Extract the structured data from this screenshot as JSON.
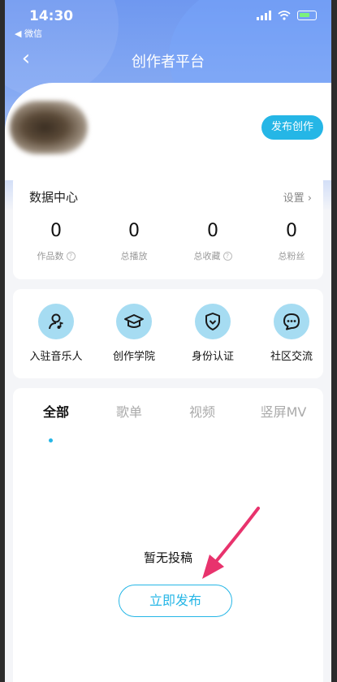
{
  "status_bar": {
    "time": "14:30",
    "back_app": "◀ 微信"
  },
  "nav": {
    "title": "创作者平台",
    "back_glyph": "‹"
  },
  "profile": {
    "publish_create_label": "发布创作"
  },
  "data_center": {
    "title": "数据中心",
    "settings_label": "设置 ›",
    "stats": [
      {
        "value": "0",
        "label": "作品数",
        "has_help": true
      },
      {
        "value": "0",
        "label": "总播放",
        "has_help": false
      },
      {
        "value": "0",
        "label": "总收藏",
        "has_help": true
      },
      {
        "value": "0",
        "label": "总粉丝",
        "has_help": false
      }
    ]
  },
  "tools": [
    {
      "label": "入驻音乐人",
      "icon": "musician-icon"
    },
    {
      "label": "创作学院",
      "icon": "graduation-cap-icon"
    },
    {
      "label": "身份认证",
      "icon": "shield-check-icon"
    },
    {
      "label": "社区交流",
      "icon": "chat-bubble-icon"
    }
  ],
  "tabs": [
    {
      "label": "全部",
      "active": true
    },
    {
      "label": "歌单",
      "active": false
    },
    {
      "label": "视频",
      "active": false
    },
    {
      "label": "竖屏MV",
      "active": false
    }
  ],
  "empty_state": {
    "message": "暂无投稿",
    "publish_now_label": "立即发布"
  },
  "colors": {
    "accent": "#25b6e6",
    "header": "#6f98f0",
    "icon_bg": "#a6dcf2",
    "arrow": "#e8336d"
  }
}
